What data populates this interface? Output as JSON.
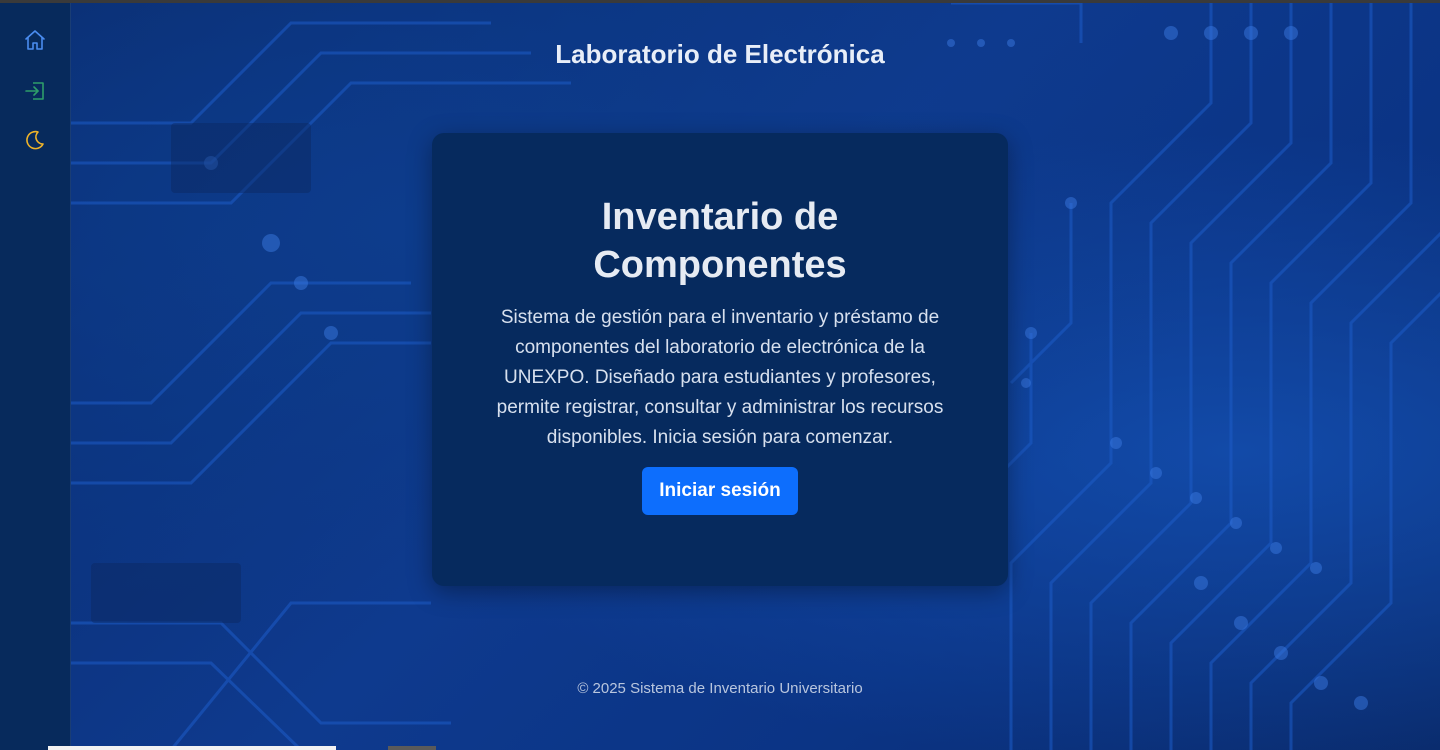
{
  "sidebar": {
    "items": [
      {
        "icon": "home-icon",
        "color": "#4a8cf0"
      },
      {
        "icon": "login-icon",
        "color": "#2e9e6a"
      },
      {
        "icon": "moon-icon",
        "color": "#f0b429"
      }
    ]
  },
  "header": {
    "title": "Laboratorio de Electrónica"
  },
  "card": {
    "title_line1": "Inventario de",
    "title_line2": "Componentes",
    "description": "Sistema de gestión para el inventario y préstamo de componentes del laboratorio de electrónica de la UNEXPO. Diseñado para estudiantes y profesores, permite registrar, consultar y administrar los recursos disponibles. Inicia sesión para comenzar.",
    "login_button": "Iniciar sesión"
  },
  "footer": {
    "text": "© 2025 Sistema de Inventario Universitario"
  },
  "colors": {
    "accent": "#0d6efd",
    "card_bg": "#062a5e",
    "sidebar_bg": "#072a5c"
  }
}
